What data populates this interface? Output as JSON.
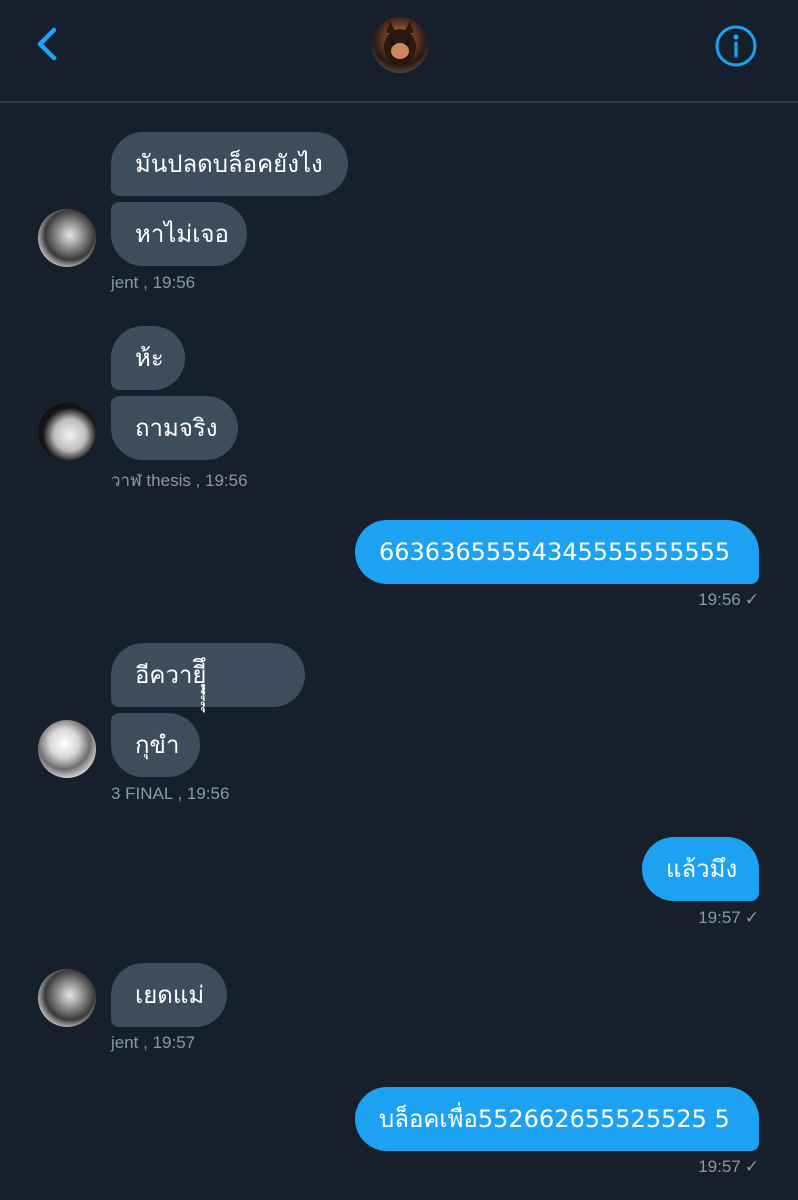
{
  "header": {
    "back_icon": "chevron-left-icon",
    "info_icon": "info-icon",
    "accent": "#1da1f2"
  },
  "colors": {
    "background": "#16202c",
    "incoming_bubble": "#3d4d5c",
    "outgoing_bubble": "#1da1f2",
    "meta_text": "#8899a6"
  },
  "messages": [
    {
      "direction": "in",
      "text": "มันปลดบล็อคยังไง"
    },
    {
      "direction": "in",
      "text": "หาไม่เจอ"
    },
    {
      "meta": "jent  , 19:56"
    },
    {
      "direction": "in",
      "text": "ห้ะ"
    },
    {
      "direction": "in",
      "text": "ถามจริง"
    },
    {
      "meta": "วาฬ thesis  , 19:56"
    },
    {
      "direction": "out",
      "text": "66363655554345555555555"
    },
    {
      "meta": "19:56"
    },
    {
      "direction": "in",
      "text": "อีควายฺฺฺีึุุุุุ"
    },
    {
      "direction": "in",
      "text": "กุขำ"
    },
    {
      "meta": "3 FINAL  , 19:56"
    },
    {
      "direction": "out",
      "text": "แล้วมึง"
    },
    {
      "meta": "19:57"
    },
    {
      "direction": "in",
      "text": "เยดแม่"
    },
    {
      "meta": "jent  , 19:57"
    },
    {
      "direction": "out",
      "text": "บล็อคเพื่อ552662655525525 5"
    },
    {
      "meta": "19:57"
    }
  ],
  "check_icon": "✓"
}
